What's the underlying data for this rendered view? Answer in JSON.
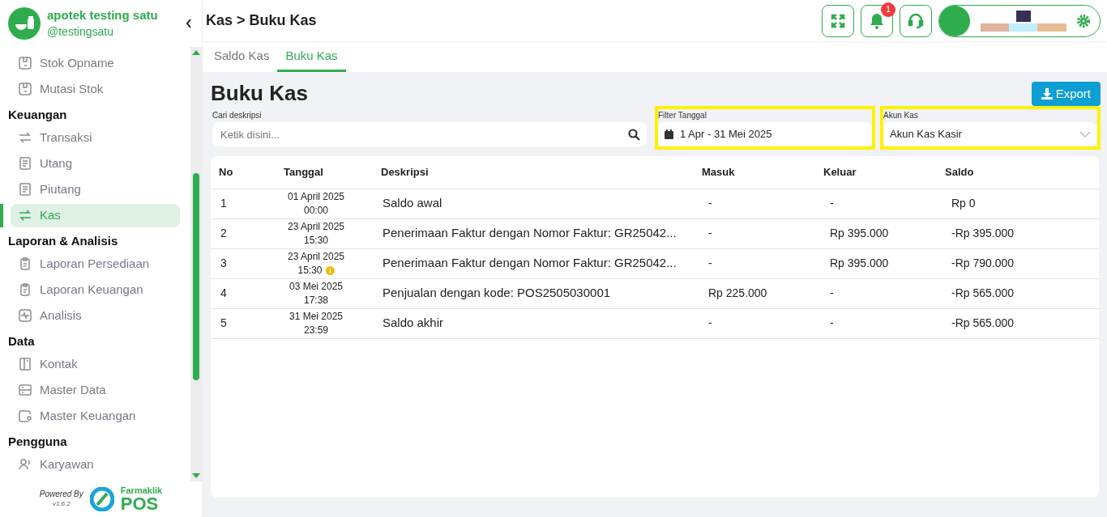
{
  "brand": {
    "name": "apotek testing satu",
    "handle": "@testingsatu"
  },
  "sidebar": {
    "items": [
      {
        "kind": "item",
        "label": "Stok Opname",
        "selected": false
      },
      {
        "kind": "item",
        "label": "Mutasi Stok",
        "selected": false
      },
      {
        "kind": "header",
        "label": "Keuangan"
      },
      {
        "kind": "item",
        "label": "Transaksi",
        "selected": false
      },
      {
        "kind": "item",
        "label": "Utang",
        "selected": false
      },
      {
        "kind": "item",
        "label": "Piutang",
        "selected": false
      },
      {
        "kind": "item",
        "label": "Kas",
        "selected": true
      },
      {
        "kind": "header",
        "label": "Laporan & Analisis"
      },
      {
        "kind": "item",
        "label": "Laporan Persediaan",
        "selected": false
      },
      {
        "kind": "item",
        "label": "Laporan Keuangan",
        "selected": false
      },
      {
        "kind": "item",
        "label": "Analisis",
        "selected": false
      },
      {
        "kind": "header",
        "label": "Data"
      },
      {
        "kind": "item",
        "label": "Kontak",
        "selected": false
      },
      {
        "kind": "item",
        "label": "Master Data",
        "selected": false
      },
      {
        "kind": "item",
        "label": "Master Keuangan",
        "selected": false
      },
      {
        "kind": "header",
        "label": "Pengguna"
      },
      {
        "kind": "item",
        "label": "Karyawan",
        "selected": false
      }
    ]
  },
  "footer": {
    "powered_by": "Powered By",
    "version": "v1.6.2",
    "logo_top": "Farmaklik",
    "logo_bottom": "POS"
  },
  "breadcrumb": "Kas > Buku Kas",
  "notifications": {
    "count": "1"
  },
  "tabs": [
    {
      "label": "Saldo Kas",
      "selected": false
    },
    {
      "label": "Buku Kas",
      "selected": true
    }
  ],
  "page_title": "Buku Kas",
  "export_button": "Export",
  "filters": [
    {
      "kind": "search",
      "label": "Cari deskripsi",
      "placeholder": "Ketik disini...",
      "highlighted": false
    },
    {
      "kind": "date",
      "label": "Filter Tanggal",
      "value": "1 Apr - 31 Mei 2025",
      "highlighted": true
    },
    {
      "kind": "select",
      "label": "Akun Kas",
      "value": "Akun Kas Kasir",
      "highlighted": true
    }
  ],
  "table": {
    "columns": [
      "No",
      "Tanggal",
      "Deskripsi",
      "Masuk",
      "Keluar",
      "Saldo"
    ],
    "rows": [
      {
        "no": "1",
        "date": "01 April 2025",
        "time": "00:00",
        "warning": false,
        "desc": "Saldo awal",
        "in": "-",
        "out": "-",
        "balance": "Rp 0"
      },
      {
        "no": "2",
        "date": "23 April 2025",
        "time": "15:30",
        "warning": false,
        "desc": "Penerimaan Faktur dengan Nomor Faktur: GR25042...",
        "in": "-",
        "out": "Rp 395.000",
        "balance": "-Rp 395.000"
      },
      {
        "no": "3",
        "date": "23 April 2025",
        "time": "15:30",
        "warning": true,
        "desc": "Penerimaan Faktur dengan Nomor Faktur: GR25042...",
        "in": "-",
        "out": "Rp 395.000",
        "balance": "-Rp 790.000"
      },
      {
        "no": "4",
        "date": "03 Mei 2025",
        "time": "17:38",
        "warning": false,
        "desc": "Penjualan dengan kode: POS2505030001",
        "in": "Rp 225.000",
        "out": "-",
        "balance": "-Rp 565.000"
      },
      {
        "no": "5",
        "date": "31 Mei 2025",
        "time": "23:59",
        "warning": false,
        "desc": "Saldo akhir",
        "in": "-",
        "out": "-",
        "balance": "-Rp 565.000"
      }
    ]
  }
}
